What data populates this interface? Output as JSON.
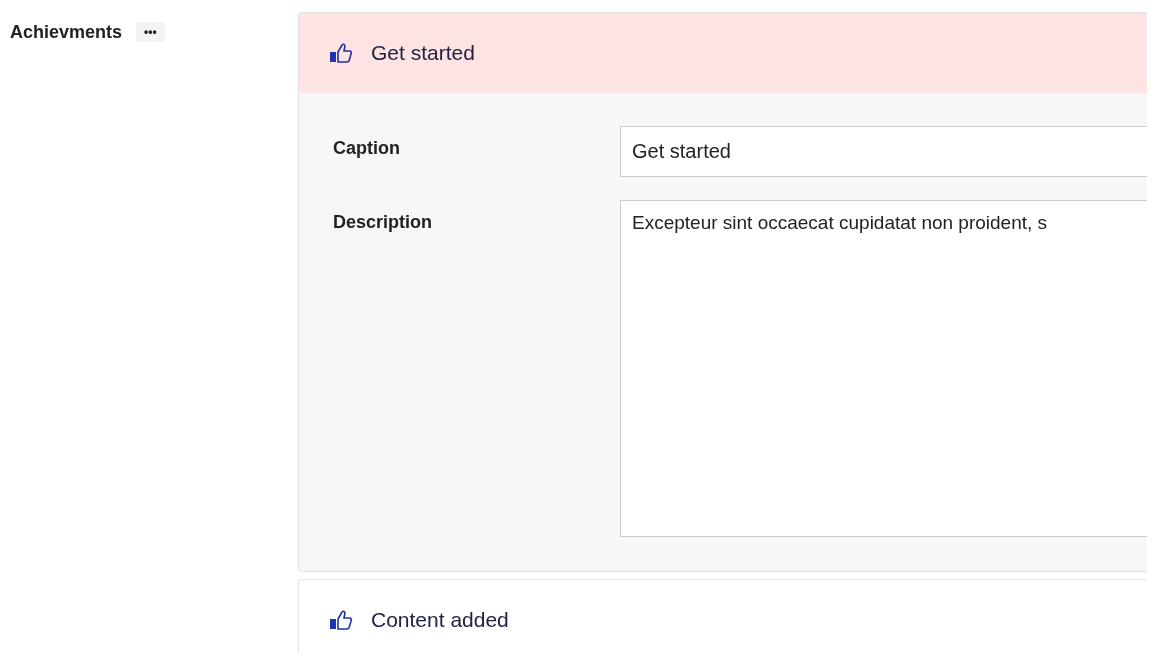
{
  "section": {
    "label": "Achievments",
    "menu": "•••"
  },
  "achievements": [
    {
      "title": "Get started",
      "expanded": true,
      "fields": [
        {
          "kind": "input",
          "label": "Caption",
          "value": "Get started"
        },
        {
          "kind": "textarea",
          "label": "Description",
          "value": "Excepteur sint occaecat cupidatat non proident, s"
        }
      ]
    },
    {
      "title": "Content added",
      "expanded": false
    }
  ]
}
